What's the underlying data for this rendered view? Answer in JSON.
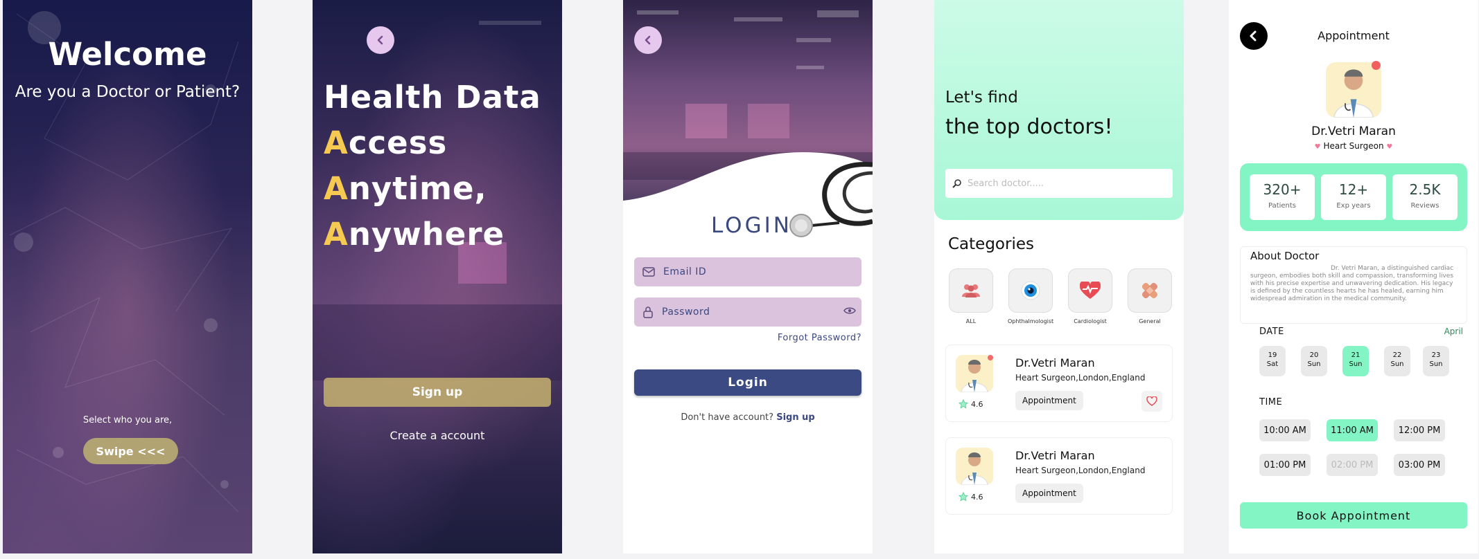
{
  "welcome": {
    "title": "Welcome",
    "subtitle": "Are you a Doctor or Patient?",
    "select_text": "Select who you are,",
    "swipe_label": "Swipe <<<"
  },
  "intro": {
    "line1": "Health Data",
    "line2_first": "A",
    "line2_rest": "ccess",
    "line3_first": "A",
    "line3_rest": "nytime,",
    "line4_first": "A",
    "line4_rest": "nywhere",
    "signup_label": "Sign up",
    "create_label": "Create a account",
    "accent_color": "#f6c950"
  },
  "login": {
    "title": "LOGIN",
    "email_placeholder": "Email ID",
    "password_placeholder": "Password",
    "forgot_label": "Forgot Password?",
    "login_label": "Login",
    "no_account_text": "Don't have account?",
    "signup_link": "Sign up",
    "brand_color": "#3b4a82"
  },
  "home": {
    "greeting_line1": "Let's find",
    "greeting_line2": "the top doctors!",
    "search_placeholder": "Search doctor.....",
    "categories_title": "Categories",
    "categories": [
      {
        "label": "ALL",
        "icon": "people-icon"
      },
      {
        "label": "Ophthalmologist",
        "icon": "eye-icon"
      },
      {
        "label": "Cardiologist",
        "icon": "heart-pulse-icon"
      },
      {
        "label": "General",
        "icon": "bandage-icon"
      }
    ],
    "doctors": [
      {
        "name": "Dr.Vetri Maran",
        "specialty": "Heart Surgeon,London,England",
        "rating": "4.6",
        "button": "Appointment"
      },
      {
        "name": "Dr.Vetri Maran",
        "specialty": "Heart Surgeon,London,England",
        "rating": "4.6",
        "button": "Appointment"
      }
    ],
    "accent_color": "#a8f7d6"
  },
  "appointment": {
    "title": "Appointment",
    "doctor_name": "Dr.Vetri Maran",
    "doctor_specialty": "Heart Surgeon",
    "stats": [
      {
        "value": "320+",
        "label": "Patients"
      },
      {
        "value": "12+",
        "label": "Exp years"
      },
      {
        "value": "2.5K",
        "label": "Reviews"
      }
    ],
    "about_title": "About Doctor",
    "about_text": "Dr. Vetri Maran, a distinguished cardiac surgeon, embodies both skill and compassion, transforming lives with his precise expertise and unwavering dedication. His legacy is defined by the countless hearts he has healed, earning him widespread admiration in the medical community.",
    "date_label": "DATE",
    "month": "April",
    "dates": [
      {
        "day": "19",
        "weekday": "Sat"
      },
      {
        "day": "20",
        "weekday": "Sun"
      },
      {
        "day": "21",
        "weekday": "Sun"
      },
      {
        "day": "22",
        "weekday": "Sun"
      },
      {
        "day": "23",
        "weekday": "Sun"
      }
    ],
    "selected_date_index": 2,
    "time_label": "TIME",
    "times": [
      "10:00 AM",
      "11:00 AM",
      "12:00 PM",
      "01:00 PM",
      "02:00 PM",
      "03:00 PM"
    ],
    "selected_time_index": 1,
    "disabled_time_index": 4,
    "book_label": "Book Appointment",
    "accent_color": "#83f4c3"
  }
}
